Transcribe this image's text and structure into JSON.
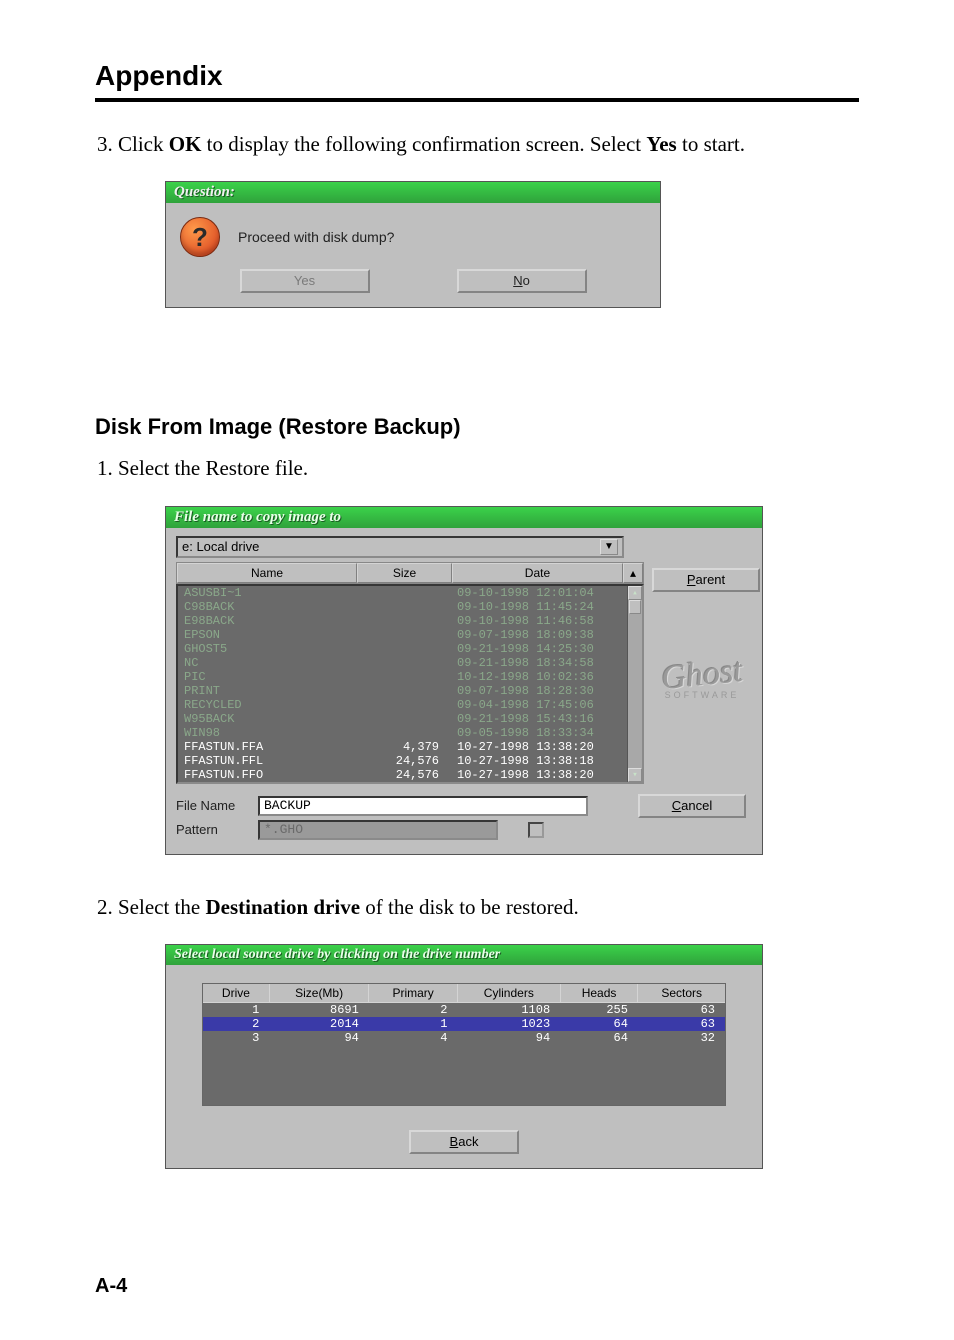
{
  "header": {
    "title": "Appendix"
  },
  "step3": {
    "num": "3.",
    "pre": " Click ",
    "b1": "OK",
    "mid": " to display the following confirmation screen.  Select ",
    "b2": "Yes",
    "post": " to start."
  },
  "dlg1": {
    "title": "Question:",
    "text": "Proceed with disk dump?",
    "yes": "Yes",
    "no_u": "N",
    "no_rest": "o"
  },
  "section2": "Disk From Image (Restore Backup)",
  "step1": {
    "num": "1.",
    "text": " Select the Restore file."
  },
  "dlg2": {
    "title": "File name to copy image to",
    "drive": "e: Local drive",
    "cols": {
      "name": "Name",
      "size": "Size",
      "date": "Date"
    },
    "parent_btn_u": "P",
    "parent_btn_rest": "arent",
    "cancel_btn_u": "C",
    "cancel_btn_rest": "ancel",
    "filename_label": "File Name",
    "filename_value": "BACKUP",
    "pattern_label": "Pattern",
    "pattern_value": "*.GHO",
    "logo": "Ghost",
    "logo_sub": "SOFTWARE",
    "files": [
      {
        "name": "ASUSBI~1",
        "size": "",
        "date": "09-10-1998 12:01:04",
        "dim": true
      },
      {
        "name": "C98BACK",
        "size": "",
        "date": "09-10-1998 11:45:24",
        "dim": true
      },
      {
        "name": "E98BACK",
        "size": "",
        "date": "09-10-1998 11:46:58",
        "dim": true
      },
      {
        "name": "EPSON",
        "size": "",
        "date": "09-07-1998 18:09:38",
        "dim": true
      },
      {
        "name": "GHOST5",
        "size": "",
        "date": "09-21-1998 14:25:30",
        "dim": true
      },
      {
        "name": "NC",
        "size": "",
        "date": "09-21-1998 18:34:58",
        "dim": true
      },
      {
        "name": "PIC",
        "size": "",
        "date": "10-12-1998 10:02:36",
        "dim": true
      },
      {
        "name": "PRINT",
        "size": "",
        "date": "09-07-1998 18:28:30",
        "dim": true
      },
      {
        "name": "RECYCLED",
        "size": "",
        "date": "09-04-1998 17:45:06",
        "dim": true
      },
      {
        "name": "W95BACK",
        "size": "",
        "date": "09-21-1998 15:43:16",
        "dim": true
      },
      {
        "name": "WIN98",
        "size": "",
        "date": "09-05-1998 18:33:34",
        "dim": true
      },
      {
        "name": "FFASTUN.FFA",
        "size": "4,379",
        "date": "10-27-1998 13:38:20",
        "dim": false
      },
      {
        "name": "FFASTUN.FFL",
        "size": "24,576",
        "date": "10-27-1998 13:38:18",
        "dim": false
      },
      {
        "name": "FFASTUN.FFO",
        "size": "24,576",
        "date": "10-27-1998 13:38:20",
        "dim": false
      }
    ]
  },
  "step2": {
    "num": "2.",
    "pre": " Select the ",
    "b1": "Destination drive",
    "post": " of the disk to be restored."
  },
  "dlg3": {
    "title": "Select local source drive by clicking on the drive number",
    "cols": [
      "Drive",
      "Size(Mb)",
      "Primary",
      "Cylinders",
      "Heads",
      "Sectors"
    ],
    "rows": [
      {
        "d": "1",
        "s": "8691",
        "p": "2",
        "c": "1108",
        "h": "255",
        "sec": "63",
        "sel": false
      },
      {
        "d": "2",
        "s": "2014",
        "p": "1",
        "c": "1023",
        "h": "64",
        "sec": "63",
        "sel": true
      },
      {
        "d": "3",
        "s": "94",
        "p": "4",
        "c": "94",
        "h": "64",
        "sec": "32",
        "sel": false
      }
    ],
    "back_u": "B",
    "back_rest": "ack"
  },
  "page_num": "A-4"
}
